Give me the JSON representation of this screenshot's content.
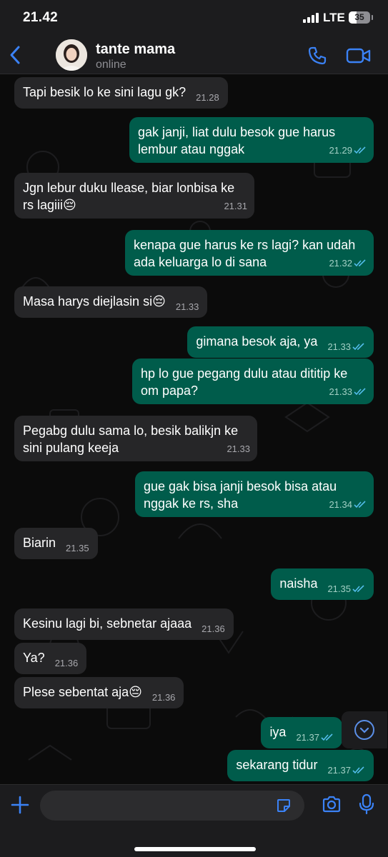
{
  "status_bar": {
    "time": "21.42",
    "network": "LTE",
    "battery": "35",
    "battery_level": 0.35
  },
  "header": {
    "contact_name": "tante mama",
    "contact_status": "online"
  },
  "colors": {
    "accent": "#3b82f6",
    "outgoing_bubble": "#005c4b",
    "incoming_bubble": "#262628",
    "chat_bg": "#0b0b0b"
  },
  "messages": [
    {
      "direction": "in",
      "text": "Tapi besik lo ke sini lagu gk?",
      "time": "21.28"
    },
    {
      "direction": "out",
      "text": "gak janji, liat dulu besok gue harus lembur atau nggak",
      "time": "21.29",
      "read": true
    },
    {
      "direction": "in",
      "text": "Jgn lebur duku llease, biar lonbisa ke rs lagiii😔",
      "time": "21.31"
    },
    {
      "direction": "out",
      "text": "kenapa gue harus ke rs lagi? kan udah ada keluarga lo di sana",
      "time": "21.32",
      "read": true
    },
    {
      "direction": "in",
      "text": "Masa harys diejlasin si😔",
      "time": "21.33"
    },
    {
      "direction": "out",
      "text": "gimana besok aja, ya",
      "time": "21.33",
      "read": true
    },
    {
      "direction": "out",
      "text": "hp lo gue pegang dulu atau dititip ke om papa?",
      "time": "21.33",
      "read": true
    },
    {
      "direction": "in",
      "text": "Pegabg dulu sama lo, besik balikjn ke sini pulang keeja",
      "time": "21.33"
    },
    {
      "direction": "out",
      "text": "gue gak bisa janji besok bisa atau nggak ke rs, sha",
      "time": "21.34",
      "read": true
    },
    {
      "direction": "in",
      "text": "Biarin",
      "time": "21.35"
    },
    {
      "direction": "out",
      "text": "naisha",
      "time": "21.35",
      "read": true
    },
    {
      "direction": "in",
      "text": "Kesinu lagi bi, sebnetar ajaaa",
      "time": "21.36"
    },
    {
      "direction": "in",
      "text": "Ya?",
      "time": "21.36"
    },
    {
      "direction": "in",
      "text": "Plese sebentat aja😔",
      "time": "21.36"
    },
    {
      "direction": "out",
      "text": "iya",
      "time": "21.37",
      "read": true
    },
    {
      "direction": "out",
      "text": "sekarang tidur",
      "time": "21.37",
      "read": true
    }
  ],
  "input": {
    "placeholder": "",
    "value": ""
  },
  "icons": [
    "back-chevron-icon",
    "phone-icon",
    "video-camera-icon",
    "plus-icon",
    "sticker-icon",
    "camera-icon",
    "microphone-icon",
    "scroll-down-icon",
    "read-ticks-icon"
  ]
}
